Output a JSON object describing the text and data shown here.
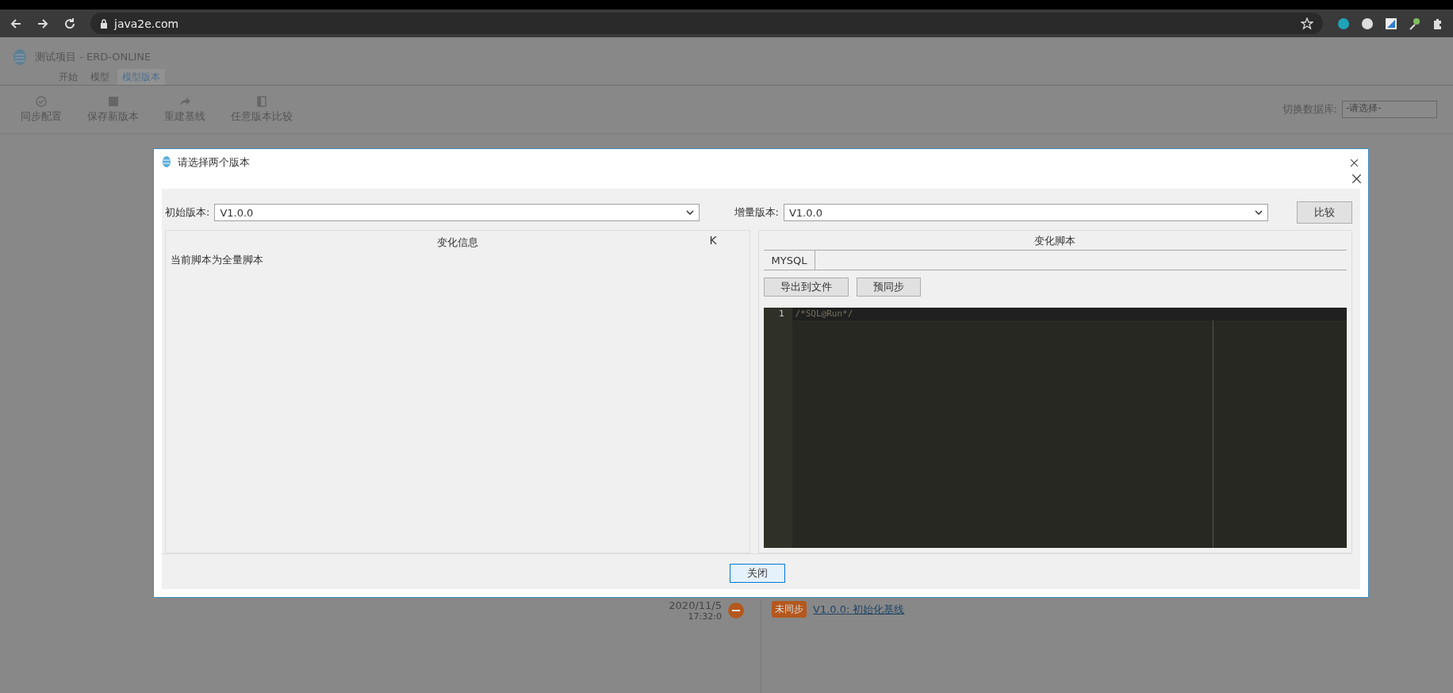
{
  "browser": {
    "url": "java2e.com"
  },
  "app": {
    "title": "测试项目 - ERD-ONLINE",
    "menu_tabs": [
      {
        "label": "开始",
        "selected": false
      },
      {
        "label": "模型",
        "selected": false
      },
      {
        "label": "模型版本",
        "selected": true
      }
    ],
    "toolbar": [
      {
        "label": "同步配置"
      },
      {
        "label": "保存新版本"
      },
      {
        "label": "重建基线"
      },
      {
        "label": "任意版本比较"
      }
    ],
    "database": {
      "label": "切换数据库:",
      "value": "-请选择-"
    }
  },
  "timeline": [
    {
      "date": "2020/11/5",
      "time": "17:32:0",
      "status": "未同步",
      "title": "V1.0.0: 初始化基线"
    }
  ],
  "dialog": {
    "title": "请选择两个版本",
    "base": {
      "label": "初始版本:",
      "value": "V1.0.0"
    },
    "incr": {
      "label": "增量版本:",
      "value": "V1.0.0"
    },
    "compare_button": "比较",
    "changes": {
      "title": "变化信息",
      "corner": "K",
      "message": "当前脚本为全量脚本"
    },
    "script": {
      "title": "变化脚本",
      "tabs": [
        {
          "label": "MYSQL",
          "selected": true
        }
      ],
      "buttons": [
        "导出到文件",
        "预同步"
      ],
      "lines": [
        {
          "number": "1",
          "code": "/*SQL@Run*/"
        }
      ]
    },
    "close_button": "关闭"
  }
}
